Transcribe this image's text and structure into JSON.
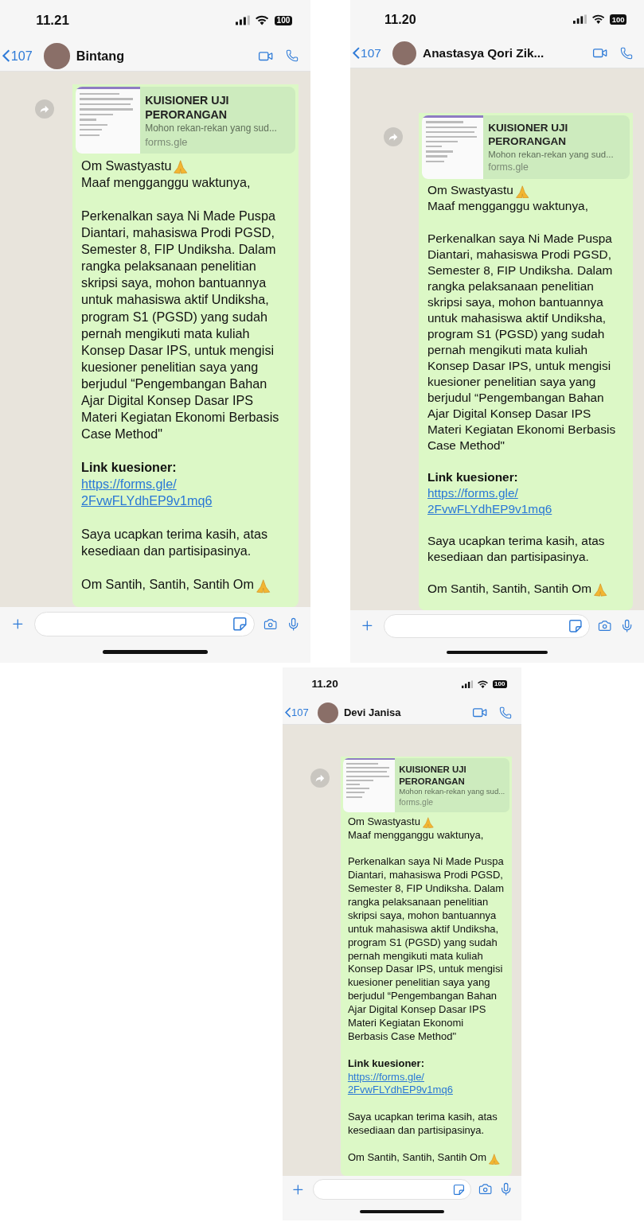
{
  "phones": [
    {
      "status_bar": {
        "time": "11.21",
        "battery": "100"
      },
      "header": {
        "back_count": "107",
        "contact_name": "Bintang"
      },
      "message": {
        "preview": {
          "title": "KUISIONER UJI PERORANGAN",
          "description": "Mohon rekan-rekan yang sud...",
          "domain": "forms.gle"
        },
        "groups": [
          [
            {
              "kind": "greeting",
              "text": "Om Swastyastu"
            },
            {
              "kind": "text",
              "text": "Maaf mengganggu waktunya,"
            }
          ],
          [
            {
              "kind": "text",
              "text": "Perkenalkan saya Ni Made Puspa Diantari, mahasiswa Prodi PGSD, Semester 8, FIP Undiksha. Dalam rangka pelaksanaan penelitian skripsi saya, mohon bantuannya untuk mahasiswa aktif Undiksha, program S1 (PGSD) yang sudah pernah mengikuti mata kuliah Konsep Dasar IPS, untuk mengisi kuesioner penelitian saya yang berjudul “Pengembangan Bahan Ajar Digital Konsep Dasar IPS Materi Kegiatan Ekonomi Berbasis Case Method\""
            }
          ],
          [
            {
              "kind": "heading",
              "text": "Link kuesioner:"
            },
            {
              "kind": "link",
              "text": "https://forms.gle/\n2FvwFLYdhEP9v1mq6"
            }
          ],
          [
            {
              "kind": "text",
              "text": "Saya ucapkan terima kasih, atas kesediaan dan partisipasinya."
            }
          ],
          [
            {
              "kind": "greeting",
              "text": "Om Santih, Santih, Santih Om"
            }
          ]
        ]
      }
    },
    {
      "status_bar": {
        "time": "11.20",
        "battery": "100"
      },
      "header": {
        "back_count": "107",
        "contact_name": "Anastasya Qori Zik..."
      },
      "message": {
        "preview": {
          "title": "KUISIONER UJI PERORANGAN",
          "description": "Mohon rekan-rekan yang sud...",
          "domain": "forms.gle"
        },
        "groups": [
          [
            {
              "kind": "greeting",
              "text": "Om Swastyastu"
            },
            {
              "kind": "text",
              "text": "Maaf mengganggu waktunya,"
            }
          ],
          [
            {
              "kind": "text",
              "text": "Perkenalkan saya Ni Made Puspa Diantari, mahasiswa Prodi PGSD, Semester 8, FIP Undiksha. Dalam rangka pelaksanaan penelitian skripsi saya, mohon bantuannya untuk mahasiswa aktif Undiksha, program S1 (PGSD) yang sudah pernah mengikuti mata kuliah Konsep Dasar IPS, untuk mengisi kuesioner penelitian saya yang berjudul “Pengembangan Bahan Ajar Digital Konsep Dasar IPS Materi Kegiatan Ekonomi Berbasis Case Method\""
            }
          ],
          [
            {
              "kind": "heading",
              "text": "Link kuesioner:"
            },
            {
              "kind": "link",
              "text": "https://forms.gle/\n2FvwFLYdhEP9v1mq6"
            }
          ],
          [
            {
              "kind": "text",
              "text": "Saya ucapkan terima kasih, atas kesediaan dan partisipasinya."
            }
          ],
          [
            {
              "kind": "greeting",
              "text": "Om Santih, Santih, Santih Om"
            }
          ]
        ]
      }
    },
    {
      "status_bar": {
        "time": "11.20",
        "battery": "100"
      },
      "header": {
        "back_count": "107",
        "contact_name": "Devi Janisa"
      },
      "message": {
        "preview": {
          "title": "KUISIONER UJI PERORANGAN",
          "description": "Mohon rekan-rekan yang sud...",
          "domain": "forms.gle"
        },
        "groups": [
          [
            {
              "kind": "greeting",
              "text": "Om Swastyastu"
            },
            {
              "kind": "text",
              "text": "Maaf mengganggu waktunya,"
            }
          ],
          [
            {
              "kind": "text",
              "text": "Perkenalkan saya Ni Made Puspa Diantari, mahasiswa Prodi PGSD, Semester 8, FIP Undiksha. Dalam rangka pelaksanaan penelitian skripsi saya, mohon bantuannya untuk mahasiswa aktif Undiksha, program S1 (PGSD) yang sudah pernah mengikuti mata kuliah Konsep Dasar IPS, untuk mengisi kuesioner penelitian saya yang berjudul “Pengembangan Bahan Ajar Digital Konsep Dasar IPS Materi Kegiatan Ekonomi Berbasis Case Method\""
            }
          ],
          [
            {
              "kind": "heading",
              "text": "Link kuesioner:"
            },
            {
              "kind": "link",
              "text": "https://forms.gle/\n2FvwFLYdhEP9v1mq6"
            }
          ],
          [
            {
              "kind": "text",
              "text": "Saya ucapkan terima kasih, atas kesediaan dan partisipasinya."
            }
          ],
          [
            {
              "kind": "greeting",
              "text": "Om Santih, Santih, Santih Om"
            }
          ]
        ]
      }
    }
  ]
}
